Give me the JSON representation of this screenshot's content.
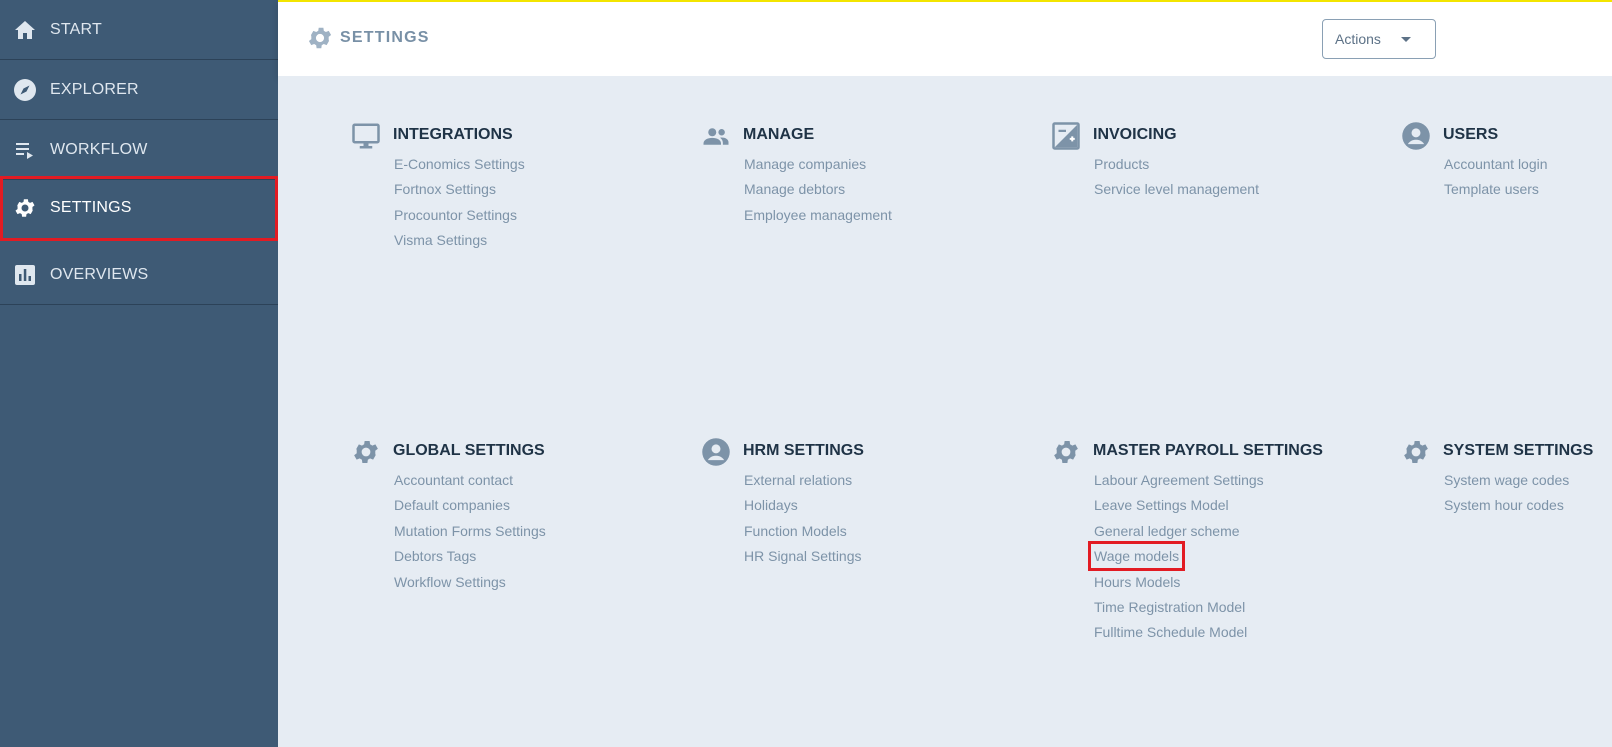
{
  "sidebar": {
    "items": [
      {
        "label": "START",
        "icon": "home-icon"
      },
      {
        "label": "EXPLORER",
        "icon": "compass-icon"
      },
      {
        "label": "WORKFLOW",
        "icon": "workflow-list-icon"
      },
      {
        "label": "SETTINGS",
        "icon": "gear-icon"
      },
      {
        "label": "OVERVIEWS",
        "icon": "bar-chart-icon"
      }
    ]
  },
  "header": {
    "title": "SETTINGS",
    "actions_label": "Actions"
  },
  "sections": [
    {
      "title": "INTEGRATIONS",
      "icon": "monitor-icon",
      "links": [
        "E-Conomics Settings",
        "Fortnox Settings",
        "Procountor Settings",
        "Visma Settings"
      ]
    },
    {
      "title": "MANAGE",
      "icon": "people-icon",
      "links": [
        "Manage companies",
        "Manage debtors",
        "Employee management"
      ]
    },
    {
      "title": "INVOICING",
      "icon": "invoice-icon",
      "links": [
        "Products",
        "Service level management"
      ]
    },
    {
      "title": "USERS",
      "icon": "user-circle-icon",
      "links": [
        "Accountant login",
        "Template users"
      ]
    },
    {
      "title": "GLOBAL SETTINGS",
      "icon": "gear-icon",
      "links": [
        "Accountant contact",
        "Default companies",
        "Mutation Forms Settings",
        "Debtors Tags",
        "Workflow Settings"
      ]
    },
    {
      "title": "HRM SETTINGS",
      "icon": "user-circle-icon",
      "links": [
        "External relations",
        "Holidays",
        "Function Models",
        "HR Signal Settings"
      ]
    },
    {
      "title": "MASTER PAYROLL SETTINGS",
      "icon": "gear-icon",
      "links": [
        "Labour Agreement Settings",
        "Leave Settings Model",
        "General ledger scheme",
        "Wage models",
        "Hours Models",
        "Time Registration Model",
        "Fulltime Schedule Model"
      ]
    },
    {
      "title": "SYSTEM SETTINGS",
      "icon": "gear-icon",
      "links": [
        "System wage codes",
        "System hour codes"
      ]
    }
  ],
  "colors": {
    "sidebar_bg": "#3e5a75",
    "content_bg": "#e6ecf3",
    "header_accent": "#f3e500",
    "highlight": "#e21b23",
    "link": "#7d93a8",
    "title": "#1f3346"
  }
}
